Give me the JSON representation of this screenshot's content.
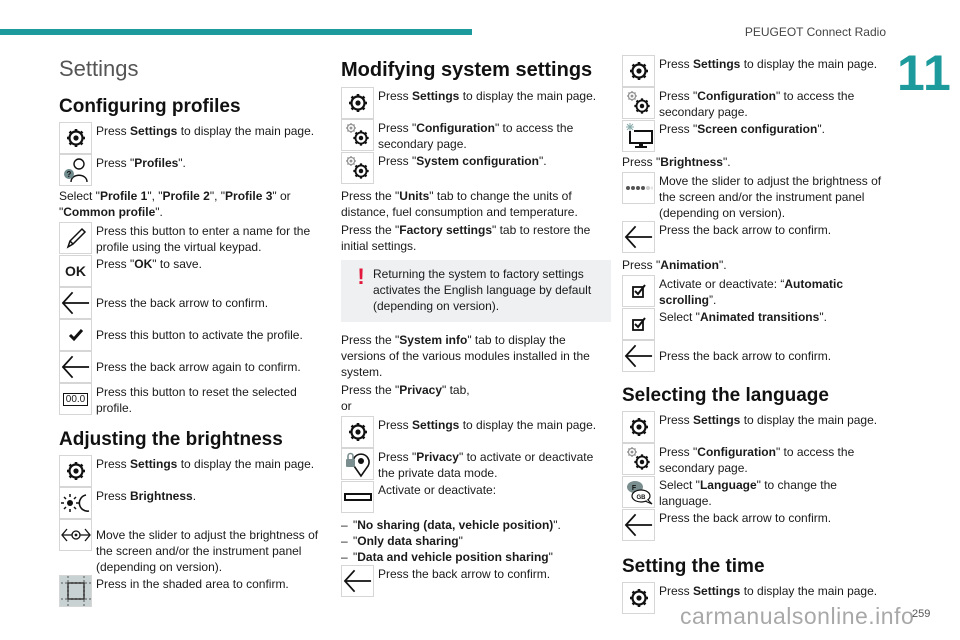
{
  "header": {
    "title": "PEUGEOT Connect Radio",
    "chapter": "11",
    "page_number": "259",
    "accent_color": "#1d9a9c",
    "watermark": "carmanualsonline.info"
  },
  "col1": {
    "section_title": "Settings",
    "profiles": {
      "heading": "Configuring profiles",
      "step1": {
        "pre": "Press ",
        "bold": "Settings",
        "post": " to display the main page."
      },
      "step2": {
        "pre": "Press \"",
        "bold": "Profiles",
        "post": "\"."
      },
      "select": {
        "pre": "Select \"",
        "b1": "Profile 1",
        "m1": "\", \"",
        "b2": "Profile 2",
        "m2": "\", \"",
        "b3": "Profile 3",
        "m3": "\" or \"",
        "b4": "Common profile",
        "post": "\"."
      },
      "step3": "Press this button to enter a name for the profile using the virtual keypad.",
      "step4": {
        "pre": "Press \"",
        "bold": "OK",
        "post": "\" to save."
      },
      "ok_icon_label": "OK",
      "step5": "Press the back arrow to confirm.",
      "step6": "Press this button to activate the profile.",
      "step7": "Press the back arrow again to confirm.",
      "step8": "Press this button to reset the selected profile.",
      "reset_icon_label": "00.0"
    },
    "brightness": {
      "heading": "Adjusting the brightness",
      "step1": {
        "pre": "Press ",
        "bold": "Settings",
        "post": " to display the main page."
      },
      "step2": {
        "pre": "Press ",
        "bold": "Brightness",
        "post": "."
      },
      "step3": "Move the slider to adjust the brightness of the screen and/or the instrument panel (depending on version).",
      "step4": "Press in the shaded area to confirm."
    }
  },
  "col2": {
    "heading": "Modifying system settings",
    "step1": {
      "pre": "Press ",
      "bold": "Settings",
      "post": " to display the main page."
    },
    "step2": {
      "pre": "Press \"",
      "bold": "Configuration",
      "post": "\" to access the secondary page."
    },
    "step3": {
      "pre": "Press \"",
      "bold": "System configuration",
      "post": "\"."
    },
    "units": {
      "pre": "Press the \"",
      "bold": "Units",
      "post": "\" tab to change the units of distance, fuel consumption and temperature."
    },
    "factory": {
      "pre": "Press the \"",
      "bold": "Factory settings",
      "post": "\" tab to restore the initial settings."
    },
    "note": "Returning the system to factory settings activates the English language by default (depending on version).",
    "sysinfo": {
      "pre": "Press the \"",
      "bold": "System info",
      "post": "\" tab to display the versions of the various modules installed in the system."
    },
    "privacy_tab": {
      "pre": "Press the \"",
      "bold": "Privacy",
      "post": "\" tab,"
    },
    "or": "or",
    "step4": {
      "pre": "Press ",
      "bold": "Settings",
      "post": " to display the main page."
    },
    "step5": {
      "pre": "Press \"",
      "bold": "Privacy",
      "post": "\" to activate or deactivate the private data mode."
    },
    "step6": "Activate or deactivate:",
    "options": [
      {
        "dash": "–",
        "pre": "\"",
        "bold": "No sharing (data, vehicle position)",
        "post": "\"."
      },
      {
        "dash": "–",
        "pre": "\"",
        "bold": "Only data sharing",
        "post": "\""
      },
      {
        "dash": "–",
        "pre": "\"",
        "bold": "Data and vehicle position sharing",
        "post": "\""
      }
    ],
    "step7": "Press the back arrow to confirm."
  },
  "col3": {
    "step1": {
      "pre": "Press ",
      "bold": "Settings",
      "post": " to display the main page."
    },
    "step2": {
      "pre": "Press \"",
      "bold": "Configuration",
      "post": "\" to access the secondary page."
    },
    "step3": {
      "pre": "Press \"",
      "bold": "Screen configuration",
      "post": "\"."
    },
    "brightness": {
      "pre": "Press \"",
      "bold": "Brightness",
      "post": "\"."
    },
    "step4": "Move the slider to adjust the brightness of the screen and/or the instrument panel (depending on version).",
    "step5": "Press the back arrow to confirm.",
    "animation": {
      "pre": "Press \"",
      "bold": "Animation",
      "post": "\"."
    },
    "step6": {
      "pre": "Activate or deactivate: “",
      "bold": "Automatic scrolling",
      "post": "”."
    },
    "step7": {
      "pre": "Select \"",
      "bold": "Animated transitions",
      "post": "\"."
    },
    "step8": "Press the back arrow to confirm.",
    "language": {
      "heading": "Selecting the language",
      "step1": {
        "pre": "Press ",
        "bold": "Settings",
        "post": " to display the main page."
      },
      "step2": {
        "pre": "Press \"",
        "bold": "Configuration",
        "post": "\" to access the secondary page."
      },
      "step3": {
        "pre": "Select \"",
        "bold": "Language",
        "post": "\" to change the language."
      },
      "step4": "Press the back arrow to confirm.",
      "lang_icon_top": "F",
      "lang_icon_bottom": "GB"
    },
    "time": {
      "heading": "Setting the time",
      "step1": {
        "pre": "Press ",
        "bold": "Settings",
        "post": " to display the main page."
      }
    }
  }
}
